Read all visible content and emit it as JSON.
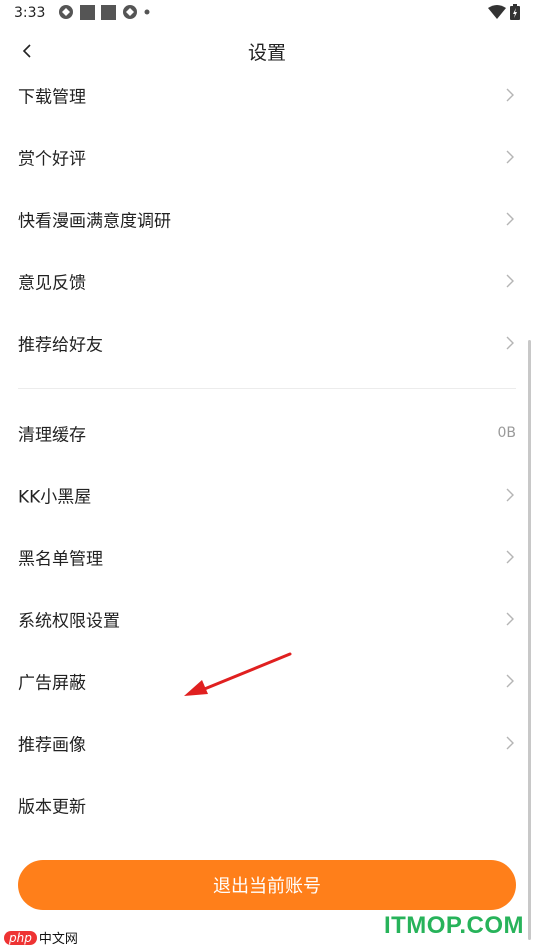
{
  "status_bar": {
    "time": "3:33"
  },
  "header": {
    "title": "设置"
  },
  "group1": [
    {
      "label": "下载管理"
    },
    {
      "label": "赏个好评"
    },
    {
      "label": "快看漫画满意度调研"
    },
    {
      "label": "意见反馈"
    },
    {
      "label": "推荐给好友"
    }
  ],
  "group2": [
    {
      "label": "清理缓存",
      "value": "0B"
    },
    {
      "label": "KK小黑屋"
    },
    {
      "label": "黑名单管理"
    },
    {
      "label": "系统权限设置"
    },
    {
      "label": "广告屏蔽"
    },
    {
      "label": "推荐画像"
    },
    {
      "label": "版本更新"
    }
  ],
  "logout": {
    "label": "退出当前账号"
  },
  "colors": {
    "accent": "#ff7f1a",
    "annotation_arrow": "#e02020",
    "watermark_green": "#27b35a"
  },
  "watermarks": {
    "left_badge": "php",
    "left_text": "中文网",
    "right_text": "ITMOP.COM"
  }
}
